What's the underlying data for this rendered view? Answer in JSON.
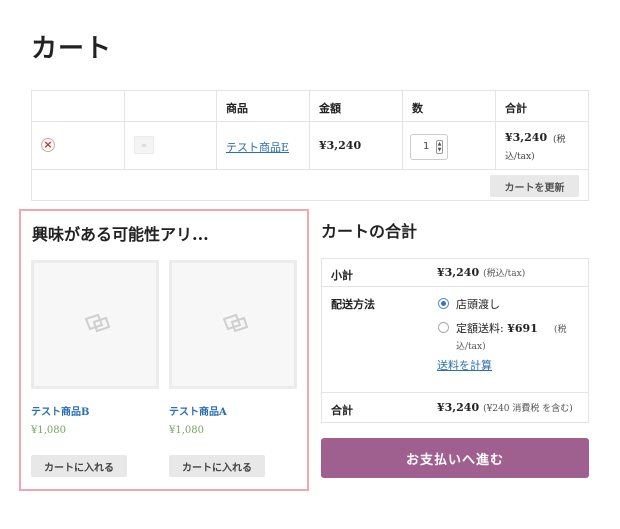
{
  "page": {
    "title": "カート"
  },
  "cart_table": {
    "headers": [
      "",
      "",
      "商品",
      "金額",
      "数",
      "合計"
    ],
    "item": {
      "remove_icon": "×",
      "product_name": "テスト商品E",
      "price": "¥3,240",
      "quantity": "1",
      "subtotal": "¥3,240",
      "subtotal_tax_line1": "(税",
      "subtotal_tax_line2": "込/tax)"
    },
    "update_button": "カートを更新"
  },
  "cross_sells": {
    "title": "興味がある可能性アリ...",
    "products": [
      {
        "name": "テスト商品B",
        "price": "¥1,080",
        "button": "カートに入れる"
      },
      {
        "name": "テスト商品A",
        "price": "¥1,080",
        "button": "カートに入れる"
      }
    ]
  },
  "totals": {
    "title": "カートの合計",
    "subtotal_label": "小計",
    "subtotal_value": "¥3,240",
    "subtotal_note": "(税込/tax)",
    "shipping_label": "配送方法",
    "shipping_options": [
      {
        "label": "店頭渡し",
        "selected": true
      },
      {
        "label": "定額送料:",
        "price": "¥691",
        "selected": false
      }
    ],
    "shipping_note_line1": "(税",
    "shipping_note_line2": "込/tax)",
    "calc_shipping_link": "送料を計算",
    "total_label": "合計",
    "total_value": "¥3,240",
    "total_note": "(¥240 消費税 を含む)"
  },
  "checkout": {
    "label": "お支払いへ進む"
  },
  "colors": {
    "accent": "#a0608f",
    "link": "#2a6fb3",
    "price_green": "#77a464",
    "highlight_border": "#f2a6ad"
  }
}
